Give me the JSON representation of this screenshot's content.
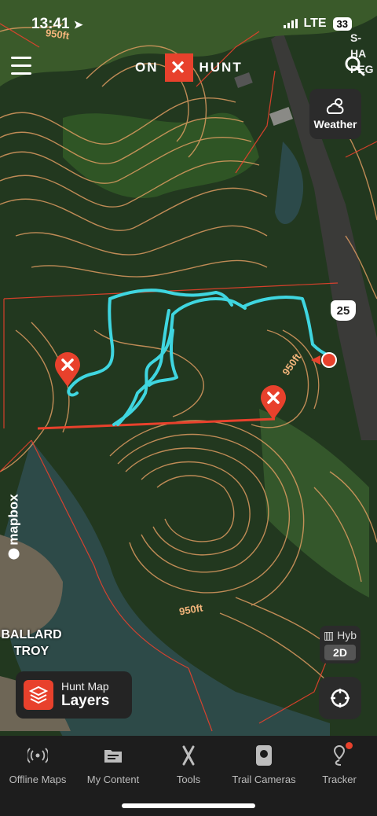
{
  "status_bar": {
    "time": "13:41",
    "network": "LTE",
    "battery": "33"
  },
  "header": {
    "logo_left": "ON",
    "logo_mark": "✕",
    "logo_right": "HUNT"
  },
  "map": {
    "weather_label": "Weather",
    "route_number": "25",
    "elevation_labels": [
      "950ft",
      "950ft",
      "950ft"
    ],
    "top_left_label": "950ft",
    "top_right_labels": [
      "S-HA",
      "PEG"
    ],
    "place_label_1": "BALLARD",
    "place_label_2": "TROY",
    "attribution": "mapbox",
    "view_mode": "Hyb",
    "dimension": "2D",
    "layers_small": "Hunt Map",
    "layers_big": "Layers",
    "colors": {
      "track": "#3fd6e0",
      "boundary": "#e8412c",
      "contours": "#e7a064"
    }
  },
  "tabs": [
    {
      "label": "Offline Maps",
      "icon": "offline-signal-icon"
    },
    {
      "label": "My Content",
      "icon": "folder-icon"
    },
    {
      "label": "Tools",
      "icon": "tools-icon"
    },
    {
      "label": "Trail Cameras",
      "icon": "camera-icon"
    },
    {
      "label": "Tracker",
      "icon": "tracker-pin-icon"
    }
  ]
}
